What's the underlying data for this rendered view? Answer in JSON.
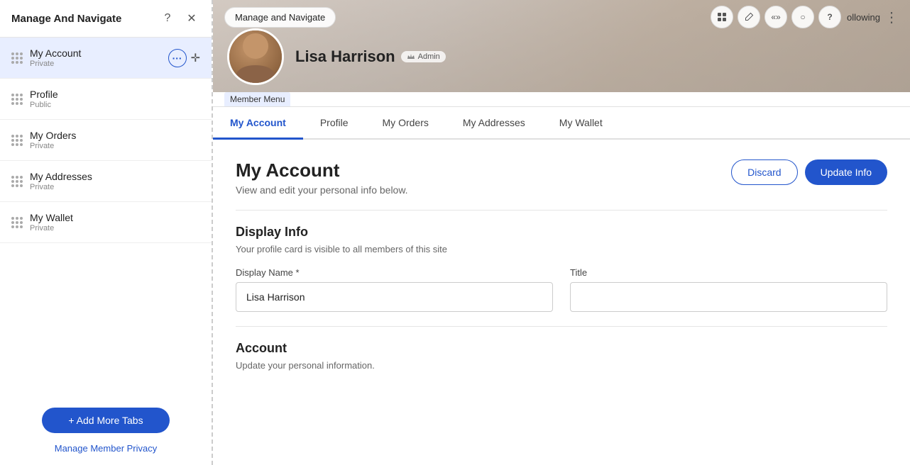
{
  "leftPanel": {
    "header": {
      "title": "Manage And Navigate",
      "help_icon": "?",
      "close_icon": "✕"
    },
    "navItems": [
      {
        "id": "my-account",
        "label": "My Account",
        "sublabel": "Private",
        "active": true
      },
      {
        "id": "profile",
        "label": "Profile",
        "sublabel": "Public",
        "active": false
      },
      {
        "id": "my-orders",
        "label": "My Orders",
        "sublabel": "Private",
        "active": false
      },
      {
        "id": "my-addresses",
        "label": "My Addresses",
        "sublabel": "Private",
        "active": false
      },
      {
        "id": "my-wallet",
        "label": "My Wallet",
        "sublabel": "Private",
        "active": false
      }
    ],
    "footer": {
      "add_tabs_label": "+ Add More Tabs",
      "manage_privacy_label": "Manage Member Privacy"
    }
  },
  "rightPanel": {
    "profile": {
      "name": "Lisa Harrison",
      "badge": "Admin"
    },
    "toolbar": {
      "manage_navigate_btn": "Manage and Navigate",
      "following_label": "ollowing"
    },
    "memberMenuLabel": "Member Menu",
    "tabs": [
      {
        "id": "my-account",
        "label": "My Account",
        "active": true
      },
      {
        "id": "profile",
        "label": "Profile",
        "active": false
      },
      {
        "id": "my-orders",
        "label": "My Orders",
        "active": false
      },
      {
        "id": "my-addresses",
        "label": "My Addresses",
        "active": false
      },
      {
        "id": "my-wallet",
        "label": "My Wallet",
        "active": false
      }
    ],
    "content": {
      "title": "My Account",
      "subtitle": "View and edit your personal info below.",
      "discard_btn": "Discard",
      "update_btn": "Update Info",
      "displayInfo": {
        "section_title": "Display Info",
        "section_subtitle": "Your profile card is visible to all members of this site",
        "display_name_label": "Display Name *",
        "display_name_value": "Lisa Harrison",
        "title_label": "Title",
        "title_value": ""
      },
      "account": {
        "section_title": "Account",
        "section_subtitle": "Update your personal information."
      }
    }
  }
}
